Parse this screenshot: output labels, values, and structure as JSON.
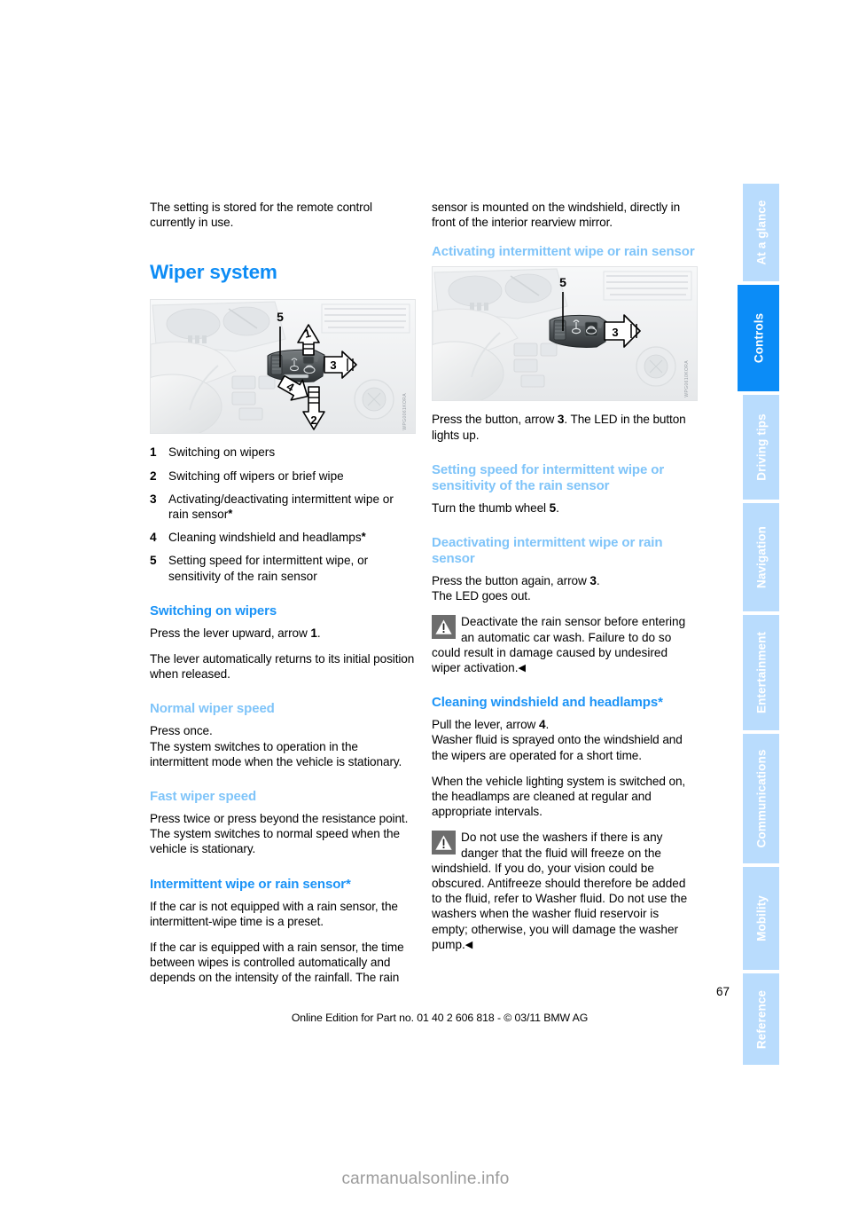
{
  "document": {
    "page_number": "67",
    "edition_line": "Online Edition for Part no. 01 40 2 606 818 - © 03/11 BMW AG",
    "watermark": "carmanualsonline.info",
    "accent_color": "#0d8cf5",
    "accent_pale_color": "#7fc4f9",
    "tab_inactive_color": "#b9dcfd",
    "tab_active_color": "#0b8cf7"
  },
  "tabs": [
    {
      "label": "At a glance",
      "active": false
    },
    {
      "label": "Controls",
      "active": true
    },
    {
      "label": "Driving tips",
      "active": false
    },
    {
      "label": "Navigation",
      "active": false
    },
    {
      "label": "Entertainment",
      "active": false
    },
    {
      "label": "Communications",
      "active": false
    },
    {
      "label": "Mobility",
      "active": false
    },
    {
      "label": "Reference",
      "active": false
    }
  ],
  "left_column": {
    "intro": "The setting is stored for the remote control currently in use.",
    "main_heading": "Wiper system",
    "figure_caption_vertical": "WPG0061KORA",
    "legend": [
      {
        "num": "1",
        "text": "Switching on wipers",
        "star": false
      },
      {
        "num": "2",
        "text": "Switching off wipers or brief wipe",
        "star": false
      },
      {
        "num": "3",
        "text": "Activating/deactivating intermittent wipe or rain sensor",
        "star": true
      },
      {
        "num": "4",
        "text": "Cleaning windshield and headlamps",
        "star": true
      },
      {
        "num": "5",
        "text": "Setting speed for intermittent wipe, or sensitivity of the rain sensor",
        "star": false
      }
    ],
    "sections": [
      {
        "heading": "Switching on wipers",
        "heading_style": "bold",
        "paragraphs": [
          "Press the lever upward, arrow 1.",
          "The lever automatically returns to its initial position when released."
        ]
      },
      {
        "heading": "Normal wiper speed",
        "heading_style": "pale",
        "paragraphs": [
          "Press once.",
          "The system switches to operation in the intermittent mode when the vehicle is stationary."
        ]
      },
      {
        "heading": "Fast wiper speed",
        "heading_style": "pale",
        "paragraphs": [
          "Press twice or press beyond the resistance point.",
          "The system switches to normal speed when the vehicle is stationary."
        ]
      },
      {
        "heading": "Intermittent wipe or rain sensor*",
        "heading_style": "bold",
        "paragraphs": [
          "If the car is not equipped with a rain sensor, the intermittent-wipe time is a preset.",
          "If the car is equipped with a rain sensor, the time between wipes is controlled automatically and depends on the intensity of the rainfall. The rain"
        ]
      }
    ]
  },
  "right_column": {
    "continuation": "sensor is mounted on the windshield, directly in front of the interior rearview mirror.",
    "figure_caption_vertical": "WPG0610KORA",
    "sections": [
      {
        "heading": "Activating intermittent wipe or rain sensor",
        "heading_style": "pale",
        "paragraphs": []
      },
      {
        "heading": "",
        "heading_style": "none",
        "paragraphs": [
          "Press the button, arrow 3. The LED in the button lights up."
        ]
      },
      {
        "heading": "Setting speed for intermittent wipe or sensitivity of the rain sensor",
        "heading_style": "pale",
        "paragraphs": [
          "Turn the thumb wheel 5."
        ]
      },
      {
        "heading": "Deactivating intermittent wipe or rain sensor",
        "heading_style": "pale",
        "paragraphs": [
          "Press the button again, arrow 3.",
          "The LED goes out."
        ]
      }
    ],
    "warning_1": "Deactivate the rain sensor before entering an automatic car wash. Failure to do so could result in damage caused by undesired wiper activation.",
    "heading_cleaning": "Cleaning windshield and headlamps*",
    "cleaning_paragraphs": [
      "Pull the lever, arrow 4.",
      "Washer fluid is sprayed onto the windshield and the wipers are operated for a short time.",
      "When the vehicle lighting system is switched on, the headlamps are cleaned at regular and appropriate intervals."
    ],
    "warning_2": "Do not use the washers if there is any danger that the fluid will freeze on the windshield. If you do, your vision could be obscured. Antifreeze should therefore be added to the fluid, refer to Washer fluid. Do not use the washers when the washer fluid reservoir is empty; otherwise, you will damage the washer pump.",
    "end_mark": "◀"
  },
  "figures": {
    "left": {
      "name": "wiper-stalk-diagram",
      "callouts": [
        "5",
        "1",
        "3",
        "4",
        "2"
      ]
    },
    "right": {
      "name": "wiper-button-diagram",
      "callouts": [
        "5",
        "3"
      ]
    }
  }
}
